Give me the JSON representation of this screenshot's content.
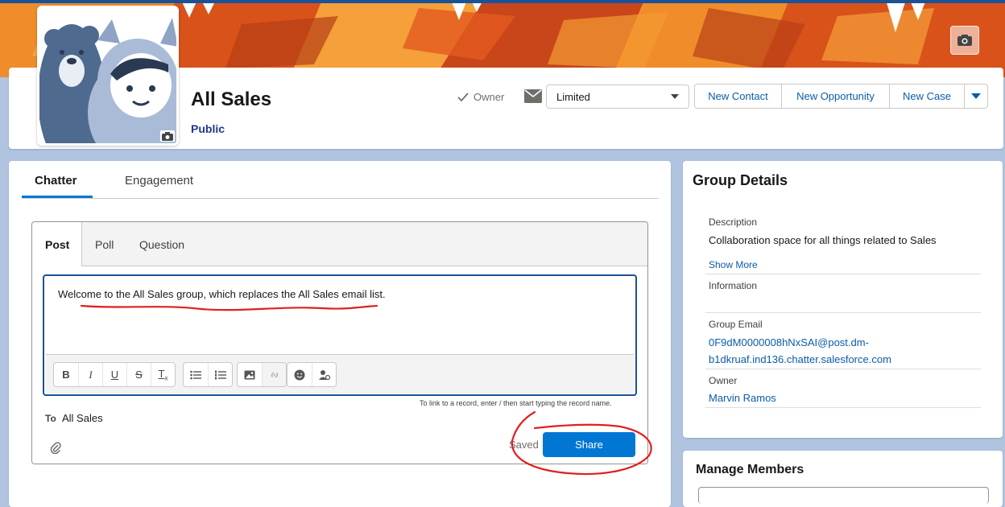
{
  "header": {
    "group_name": "All Sales",
    "visibility": "Public",
    "owner_label": "Owner",
    "email_setting": "Limited",
    "actions": [
      "New Contact",
      "New Opportunity",
      "New Case"
    ]
  },
  "tabs": [
    "Chatter",
    "Engagement"
  ],
  "publisher": {
    "tabs": [
      "Post",
      "Poll",
      "Question"
    ],
    "text": "Welcome to the All Sales group, which replaces the All Sales email list.",
    "hint": "To link to a record, enter / then start typing the record name.",
    "to_label": "To",
    "to_value": "All Sales",
    "saved_label": "Saved",
    "share_label": "Share"
  },
  "group_details": {
    "title": "Group Details",
    "description_label": "Description",
    "description": "Collaboration space for all things related to Sales",
    "show_more": "Show More",
    "information_label": "Information",
    "email_label": "Group Email",
    "email_line1": "0F9dM0000008hNxSAI@post.dm-",
    "email_line2": "b1dkruaf.ind136.chatter.salesforce.com",
    "owner_label": "Owner",
    "owner": "Marvin Ramos"
  },
  "manage_members": {
    "title": "Manage Members"
  },
  "colors": {
    "brand_blue": "#0176d3",
    "banner_orange": "#e8691a",
    "annotation_red": "#e02020"
  }
}
